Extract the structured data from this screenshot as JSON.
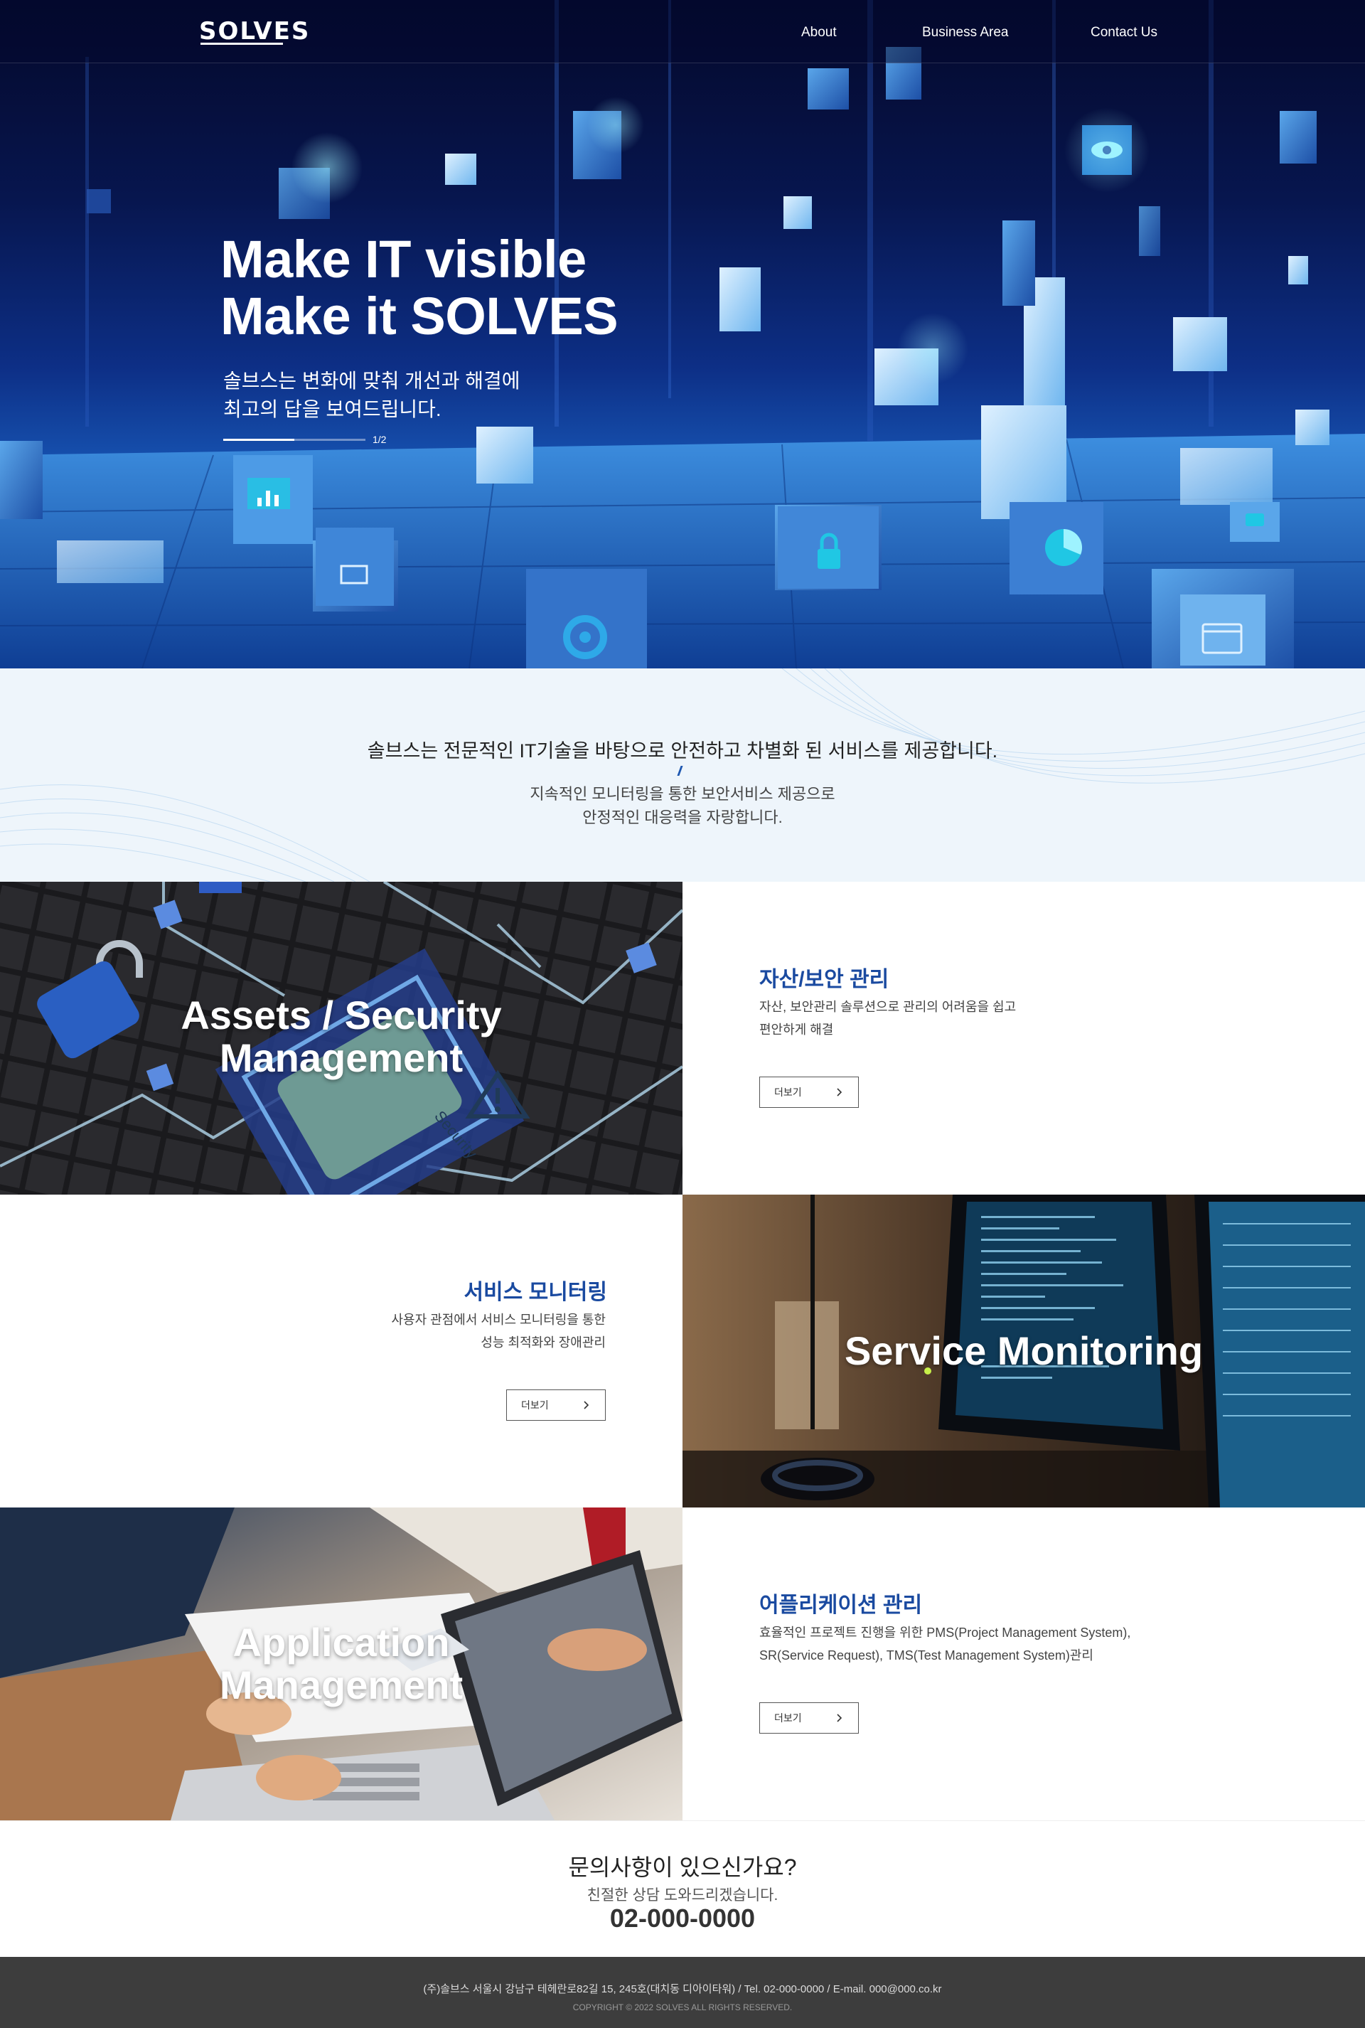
{
  "header": {
    "logo": "SOLVES",
    "nav": [
      "About",
      "Business Area",
      "Contact Us"
    ]
  },
  "hero": {
    "title_line1": "Make IT visible",
    "title_line2": "Make it SOLVES",
    "sub_line1": "솔브스는 변화에 맞춰 개선과 해결에",
    "sub_line2": "최고의 답을 보여드립니다.",
    "slide_counter": "1/2",
    "slide_progress": 0.5
  },
  "intro": {
    "headline": "솔브스는 전문적인 IT기술을 바탕으로 안전하고 차별화 된 서비스를 제공합니다.",
    "sub_line1": "지속적인 모니터링을 통한 보안서비스 제공으로",
    "sub_line2": "안정적인 대응력을 자랑합니다."
  },
  "services": [
    {
      "image_title_line1": "Assets / Security",
      "image_title_line2": "Management",
      "title": "자산/보안 관리",
      "desc_line1": "자산, 보안관리 솔루션으로 관리의 어려움을 쉽고",
      "desc_line2": "편안하게 해결",
      "button": "더보기"
    },
    {
      "image_title_line1": "Service Monitoring",
      "title": "서비스 모니터링",
      "desc_line1": "사용자 관점에서 서비스 모니터링을 통한",
      "desc_line2": "성능 최적화와 장애관리",
      "button": "더보기"
    },
    {
      "image_title_line1": "Application",
      "image_title_line2": "Management",
      "title": "어플리케이션 관리",
      "desc_line1": "효율적인 프로젝트 진행을 위한 PMS(Project Management System),",
      "desc_line2": "SR(Service Request), TMS(Test Management System)관리",
      "button": "더보기"
    }
  ],
  "contact": {
    "question": "문의사항이 있으신가요?",
    "sub": "친절한 상담 도와드리겠습니다.",
    "phone": "02-000-0000"
  },
  "footer": {
    "address": "(주)솔브스 서울시 강남구 테헤란로82길 15, 245호(대치동 디아이타워)  /  Tel. 02-000-0000  /  E-mail. 000@000.co.kr",
    "copyright": "COPYRIGHT © 2022 SOLVES ALL RIGHTS RESERVED."
  },
  "colors": {
    "hero_dark": "#04082a",
    "hero_blue": "#2f86dc",
    "accent": "#1a4aa0",
    "intro_bg": "#eef5fb",
    "footer_bg": "#3d3d3d"
  },
  "icons": [
    "chart-icon",
    "monitor-icon",
    "gear-icon",
    "lock-icon",
    "eye-icon",
    "chat-icon",
    "pie-icon",
    "browser-icon",
    "padlock-icon",
    "warning-icon",
    "chevron-right-icon"
  ]
}
